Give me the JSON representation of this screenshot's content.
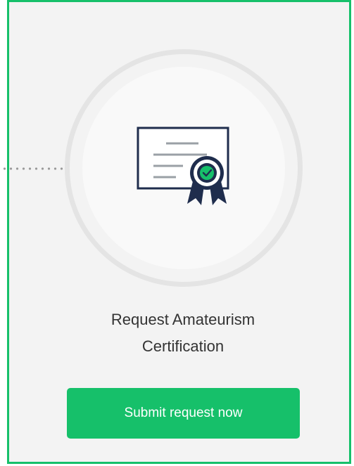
{
  "step": {
    "title_line1": "Request Amateurism",
    "title_line2": "Certification",
    "button_label": "Submit request now",
    "icon": "certificate-icon"
  },
  "colors": {
    "accent": "#16c06a",
    "icon_navy": "#1f2d4d",
    "ring": "#e4e4e4",
    "background": "#f3f3f3"
  }
}
